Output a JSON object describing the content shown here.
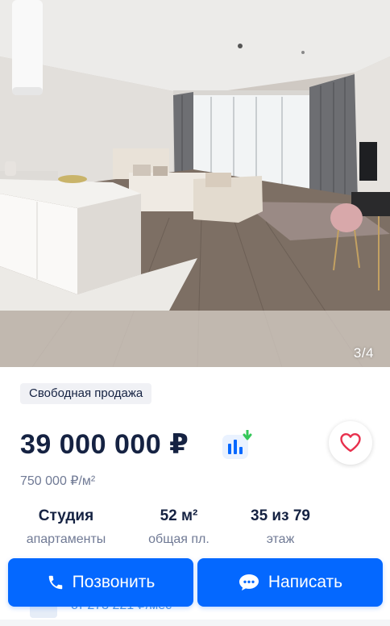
{
  "gallery": {
    "counter": "3/4"
  },
  "listing": {
    "sale_badge": "Свободная продажа",
    "price": "39 000 000 ₽",
    "price_per_m2": "750 000 ₽/м²",
    "facts": [
      {
        "value": "Студия",
        "label": "апартаменты"
      },
      {
        "value": "52 м²",
        "label": "общая пл."
      },
      {
        "value": "35 из 79",
        "label": "этаж"
      }
    ],
    "peek_text": "от 273 221 ₽/мес"
  },
  "actions": {
    "call_label": "Позвонить",
    "write_label": "Написать"
  },
  "icons": {
    "price_chart": "price-chart-icon",
    "favorite": "heart-outline-icon",
    "phone": "phone-icon",
    "chat": "chat-bubble-icon"
  },
  "colors": {
    "primary": "#0468ff",
    "favorite_heart": "#e8304d",
    "chart_bars": "#0468ff",
    "chart_arrow": "#34c759",
    "text_main": "#152242",
    "text_secondary": "#707a95"
  }
}
